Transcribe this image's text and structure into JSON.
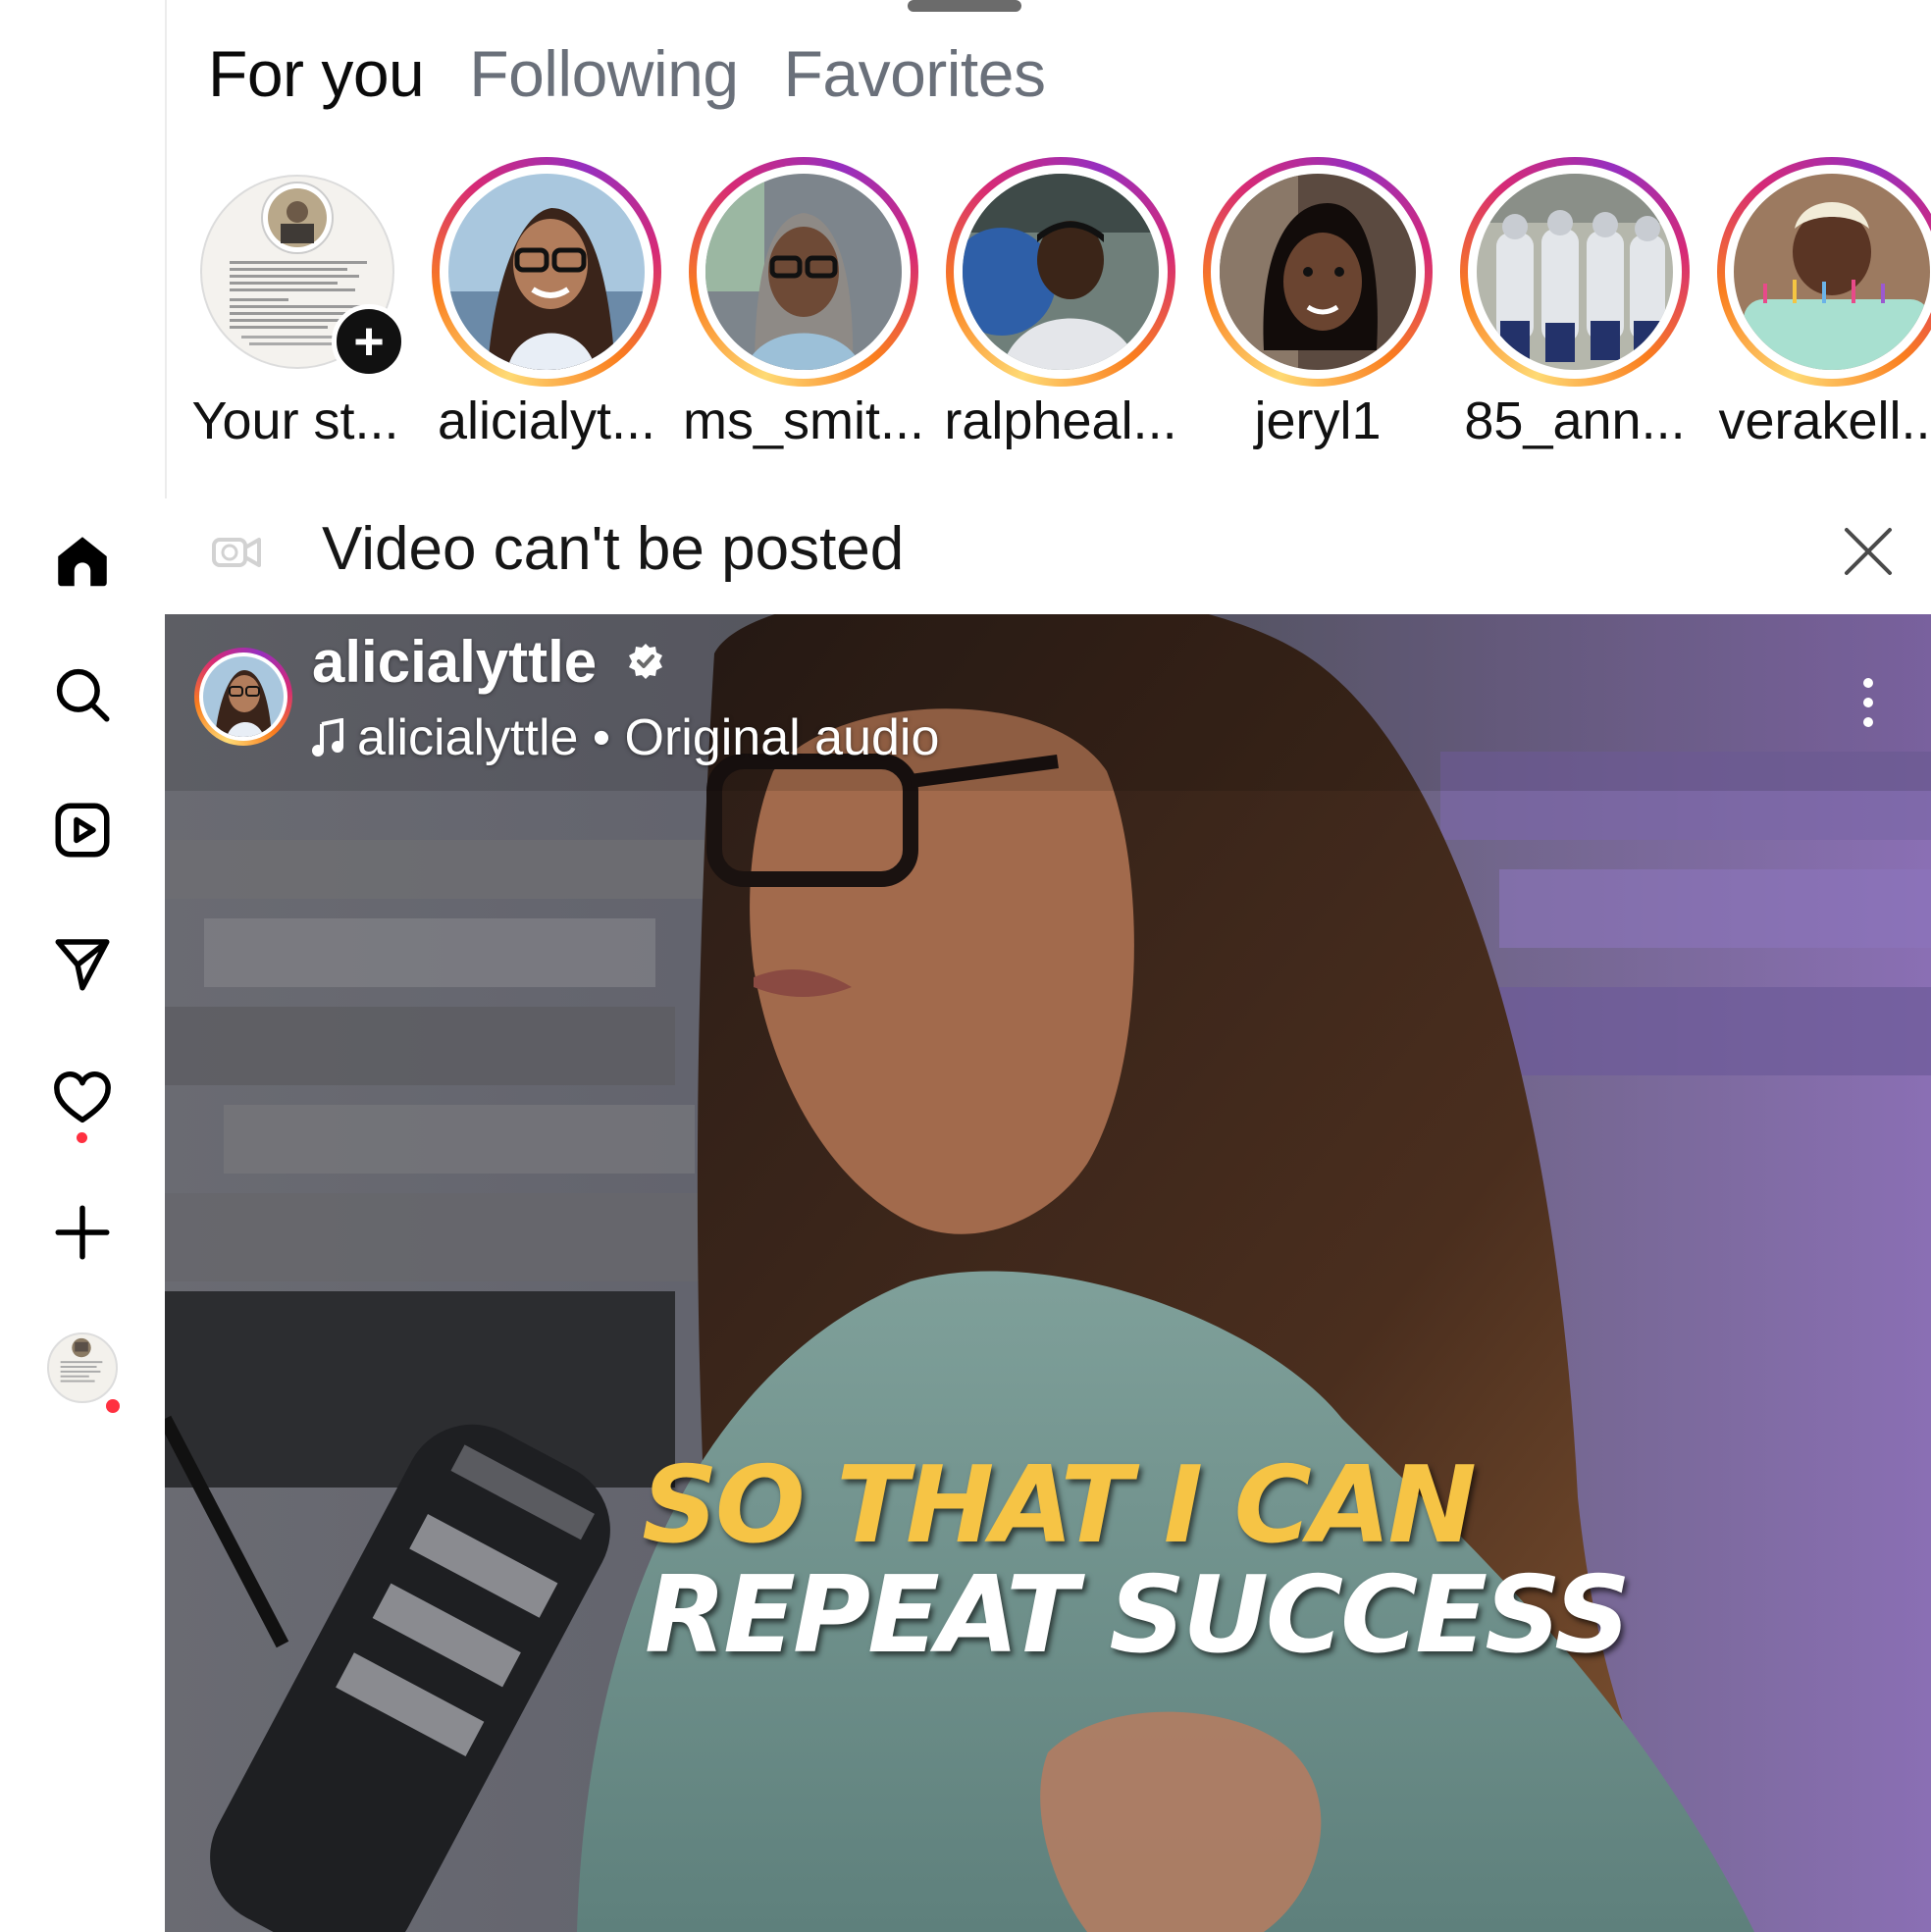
{
  "tabs": [
    {
      "label": "For you",
      "active": true
    },
    {
      "label": "Following",
      "active": false
    },
    {
      "label": "Favorites",
      "active": false
    }
  ],
  "stories": [
    {
      "label": "Your st...",
      "own": true
    },
    {
      "label": "alicialyt..."
    },
    {
      "label": "ms_smit..."
    },
    {
      "label": "ralpheal..."
    },
    {
      "label": "jeryl1"
    },
    {
      "label": "85_ann..."
    },
    {
      "label": "verakell..."
    }
  ],
  "notice": {
    "text": "Video can't be posted"
  },
  "post": {
    "username": "alicialyttle",
    "audio_label": "alicialyttle • Original audio",
    "caption_line1": "SO THAT I CAN",
    "caption_line2": "REPEAT SUCCESS"
  },
  "sidebar": {
    "items": [
      "home-icon",
      "search-icon",
      "reels-icon",
      "messages-icon",
      "notifications-icon",
      "create-icon",
      "profile-avatar"
    ]
  },
  "colors": {
    "caption_yellow": "#f6c445",
    "notification_dot": "#ff3040",
    "active_tab": "#0a0a0a",
    "inactive_tab": "#6a707a"
  }
}
